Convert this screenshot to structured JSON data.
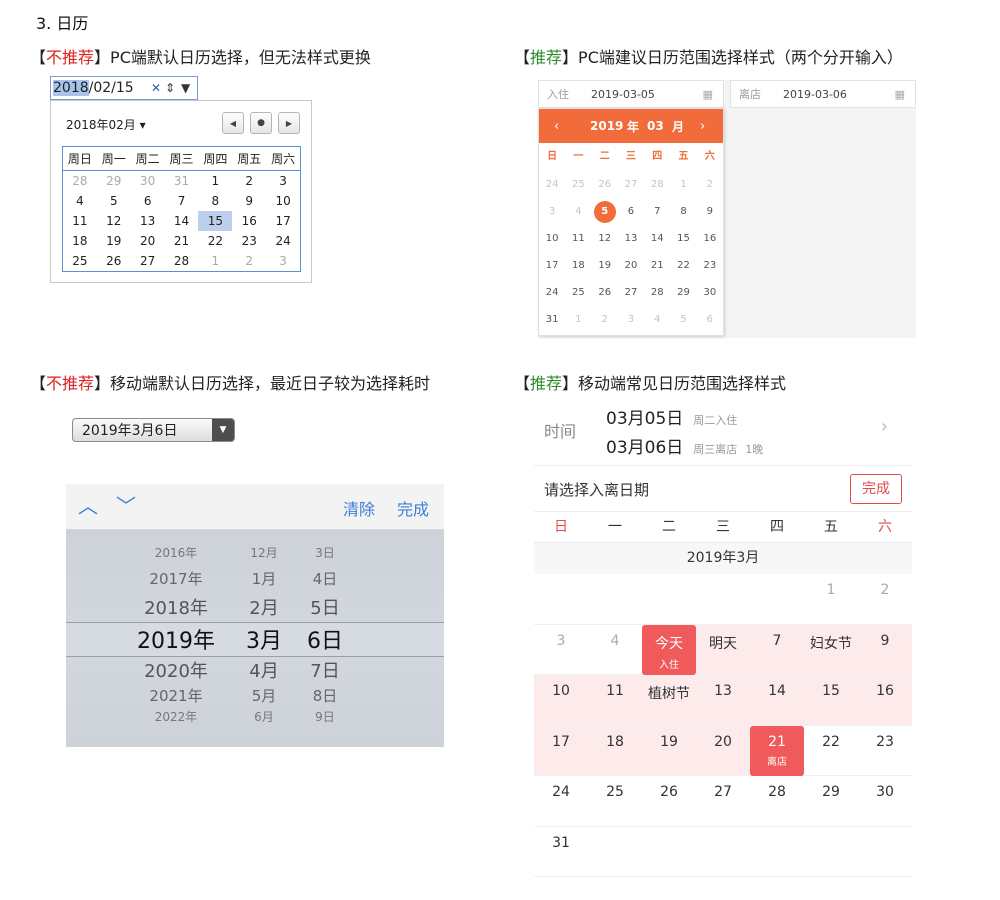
{
  "heading": "3. 日历",
  "titles": {
    "p1": {
      "open": "【",
      "mark": "不推荐",
      "close": "】",
      "text": "PC端默认日历选择，但无法样式更换"
    },
    "p2": {
      "open": "【",
      "mark": "推荐",
      "close": "】",
      "text": "PC端建议日历范围选择样式（两个分开输入）"
    },
    "p3": {
      "open": "【",
      "mark": "不推荐",
      "close": "】",
      "text": "移动端默认日历选择，最近日子较为选择耗时"
    },
    "p4": {
      "open": "【",
      "mark": "推荐",
      "close": "】",
      "text": "移动端常见日历范围选择样式"
    }
  },
  "p1": {
    "input_year": "2018",
    "input_rest": "/02/15",
    "clear_icon": "✕",
    "spin_icon": "⇕",
    "dropdown_icon": "▼",
    "month_label": "2018年02月 ▾",
    "weekdays": [
      "周日",
      "周一",
      "周二",
      "周三",
      "周四",
      "周五",
      "周六"
    ],
    "rows": [
      [
        [
          "28",
          1
        ],
        [
          "29",
          1
        ],
        [
          "30",
          1
        ],
        [
          "31",
          1
        ],
        [
          "1",
          0
        ],
        [
          "2",
          0
        ],
        [
          "3",
          0
        ]
      ],
      [
        [
          "4",
          0
        ],
        [
          "5",
          0
        ],
        [
          "6",
          0
        ],
        [
          "7",
          0
        ],
        [
          "8",
          0
        ],
        [
          "9",
          0
        ],
        [
          "10",
          0
        ]
      ],
      [
        [
          "11",
          0
        ],
        [
          "12",
          0
        ],
        [
          "13",
          0
        ],
        [
          "14",
          0
        ],
        [
          "15",
          2
        ],
        [
          "16",
          0
        ],
        [
          "17",
          0
        ]
      ],
      [
        [
          "18",
          0
        ],
        [
          "19",
          0
        ],
        [
          "20",
          0
        ],
        [
          "21",
          0
        ],
        [
          "22",
          0
        ],
        [
          "23",
          0
        ],
        [
          "24",
          0
        ]
      ],
      [
        [
          "25",
          0
        ],
        [
          "26",
          0
        ],
        [
          "27",
          0
        ],
        [
          "28",
          0
        ],
        [
          "1",
          1
        ],
        [
          "2",
          1
        ],
        [
          "3",
          1
        ]
      ]
    ]
  },
  "p2": {
    "start_label": "入住",
    "start_value": "2019-03-05",
    "end_label": "离店",
    "end_value": "2019-03-06",
    "calendar_icon": "▦",
    "year": "2019",
    "year_unit": "年",
    "month": "03",
    "month_unit": "月",
    "prev": "‹",
    "next": "›",
    "weekdays": [
      "日",
      "一",
      "二",
      "三",
      "四",
      "五",
      "六"
    ],
    "rows": [
      [
        [
          "24",
          1
        ],
        [
          "25",
          1
        ],
        [
          "26",
          1
        ],
        [
          "27",
          1
        ],
        [
          "28",
          1
        ],
        [
          "1",
          1
        ],
        [
          "2",
          1
        ]
      ],
      [
        [
          "3",
          1
        ],
        [
          "4",
          1
        ],
        [
          "5",
          2
        ],
        [
          "6",
          0
        ],
        [
          "7",
          0
        ],
        [
          "8",
          0
        ],
        [
          "9",
          0
        ]
      ],
      [
        [
          "10",
          0
        ],
        [
          "11",
          0
        ],
        [
          "12",
          0
        ],
        [
          "13",
          0
        ],
        [
          "14",
          0
        ],
        [
          "15",
          0
        ],
        [
          "16",
          0
        ]
      ],
      [
        [
          "17",
          0
        ],
        [
          "18",
          0
        ],
        [
          "19",
          0
        ],
        [
          "20",
          0
        ],
        [
          "21",
          0
        ],
        [
          "22",
          0
        ],
        [
          "23",
          0
        ]
      ],
      [
        [
          "24",
          0
        ],
        [
          "25",
          0
        ],
        [
          "26",
          0
        ],
        [
          "27",
          0
        ],
        [
          "28",
          0
        ],
        [
          "29",
          0
        ],
        [
          "30",
          0
        ]
      ],
      [
        [
          "31",
          0
        ],
        [
          "1",
          1
        ],
        [
          "2",
          1
        ],
        [
          "3",
          1
        ],
        [
          "4",
          1
        ],
        [
          "5",
          1
        ],
        [
          "6",
          1
        ]
      ]
    ]
  },
  "p3": {
    "select_value": "2019年3月6日",
    "dropdown_icon": "▼",
    "up": "︿",
    "down": "﹀",
    "clear": "清除",
    "done": "完成",
    "years": [
      "2016年",
      "2017年",
      "2018年",
      "2019年",
      "2020年",
      "2021年",
      "2022年"
    ],
    "months": [
      "12月",
      "1月",
      "2月",
      "3月",
      "4月",
      "5月",
      "6月"
    ],
    "days": [
      "3日",
      "4日",
      "5日",
      "6日",
      "7日",
      "8日",
      "9日"
    ]
  },
  "p4": {
    "time_label": "时间",
    "start_date": "03月05日",
    "start_note": "周二入住",
    "end_date": "03月06日",
    "end_note": "周三离店",
    "nights": "1晚",
    "chevron": "›",
    "prompt": "请选择入离日期",
    "done": "完成",
    "weekdays": [
      "日",
      "一",
      "二",
      "三",
      "四",
      "五",
      "六"
    ],
    "month_title": "2019年3月",
    "rows": [
      [
        [
          "",
          0,
          ""
        ],
        [
          "",
          0,
          ""
        ],
        [
          "",
          0,
          ""
        ],
        [
          "",
          0,
          ""
        ],
        [
          "",
          0,
          ""
        ],
        [
          "1",
          1,
          ""
        ],
        [
          "2",
          1,
          ""
        ]
      ],
      [
        [
          "3",
          1,
          ""
        ],
        [
          "4",
          1,
          ""
        ],
        [
          "今天",
          2,
          "入住"
        ],
        [
          "明天",
          0,
          ""
        ],
        [
          "7",
          0,
          ""
        ],
        [
          "妇女节",
          0,
          ""
        ],
        [
          "9",
          0,
          ""
        ]
      ],
      [
        [
          "10",
          0,
          ""
        ],
        [
          "11",
          0,
          ""
        ],
        [
          "植树节",
          0,
          ""
        ],
        [
          "13",
          0,
          ""
        ],
        [
          "14",
          0,
          ""
        ],
        [
          "15",
          0,
          ""
        ],
        [
          "16",
          0,
          ""
        ]
      ],
      [
        [
          "17",
          0,
          ""
        ],
        [
          "18",
          0,
          ""
        ],
        [
          "19",
          0,
          ""
        ],
        [
          "20",
          0,
          ""
        ],
        [
          "21",
          2,
          "离店"
        ],
        [
          "22",
          0,
          ""
        ],
        [
          "23",
          0,
          ""
        ]
      ],
      [
        [
          "24",
          0,
          ""
        ],
        [
          "25",
          0,
          ""
        ],
        [
          "26",
          0,
          ""
        ],
        [
          "27",
          0,
          ""
        ],
        [
          "28",
          0,
          ""
        ],
        [
          "29",
          0,
          ""
        ],
        [
          "30",
          0,
          ""
        ]
      ],
      [
        [
          "31",
          0,
          ""
        ]
      ]
    ]
  }
}
